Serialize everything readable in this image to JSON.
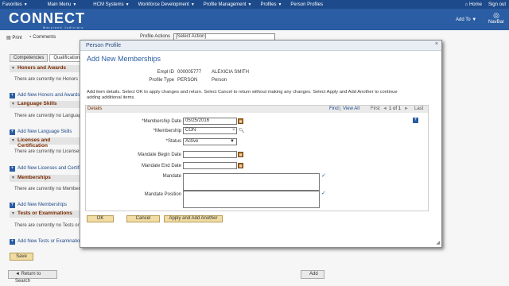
{
  "topnav": {
    "items": [
      "Favorites",
      "Main Menu",
      "HCM Systems",
      "Workforce Development",
      "Profile Management",
      "Profiles",
      "Person Profiles"
    ],
    "home": "Home",
    "signout": "Sign out"
  },
  "banner": {
    "logo": "CONNECT",
    "logo_sub": "Maryland Judiciary",
    "add_to": "Add To",
    "navbar": "NavBar"
  },
  "toolbar": {
    "print": "Print",
    "comments": "Comments",
    "profile_actions_label": "Profile Actions",
    "profile_actions_value": "[Select Action]"
  },
  "tabs": [
    "Competencies",
    "Qualifications"
  ],
  "sections": [
    {
      "title": "Honors and Awards",
      "note": "There are currently no Honors an",
      "add": "Add New Honors and Awards"
    },
    {
      "title": "Language Skills",
      "note": "There are currently no Language",
      "add": "Add New Language Skills"
    },
    {
      "title": "Licenses and Certification",
      "note": "There are currently no Licenses",
      "add": "Add New Licenses and Certific"
    },
    {
      "title": "Memberships",
      "note": "There are currently no Member",
      "add": "Add New Memberships"
    },
    {
      "title": "Tests or Examinations",
      "note": "There are currently no Tests or",
      "add": "Add New Tests or Examination"
    }
  ],
  "bottom": {
    "save": "Save",
    "return": "Return to Search",
    "add": "Add"
  },
  "modal": {
    "title": "Person Profile",
    "close": "×",
    "heading": "Add New Memberships",
    "empl_id_label": "Empl ID",
    "empl_id": "000005777",
    "name": "ALEXICIA SMITH",
    "profile_type_label": "Profile Type",
    "profile_type": "PERSON",
    "profile_type_desc": "Person",
    "instructions": "Add item details. Select OK to apply changes and return. Select Cancel to return without making any changes. Select Apply and Add Another to continue adding additional items.",
    "details_title": "Details",
    "find": "Find",
    "view_all": "View All",
    "first": "First",
    "paging": "1 of 1",
    "last": "Last",
    "membership_date_label": "*Membership Date",
    "membership_date": "05/25/2016",
    "membership_label": "*Membership",
    "membership": "CON",
    "status_label": "*Status",
    "status": "Active",
    "mandate_begin_label": "Mandate Begin Date",
    "mandate_end_label": "Mandate End Date",
    "mandate_label": "Mandate",
    "mandate_position_label": "Mandate Position",
    "ok": "OK",
    "cancel": "Cancel",
    "apply": "Apply and Add Another"
  }
}
